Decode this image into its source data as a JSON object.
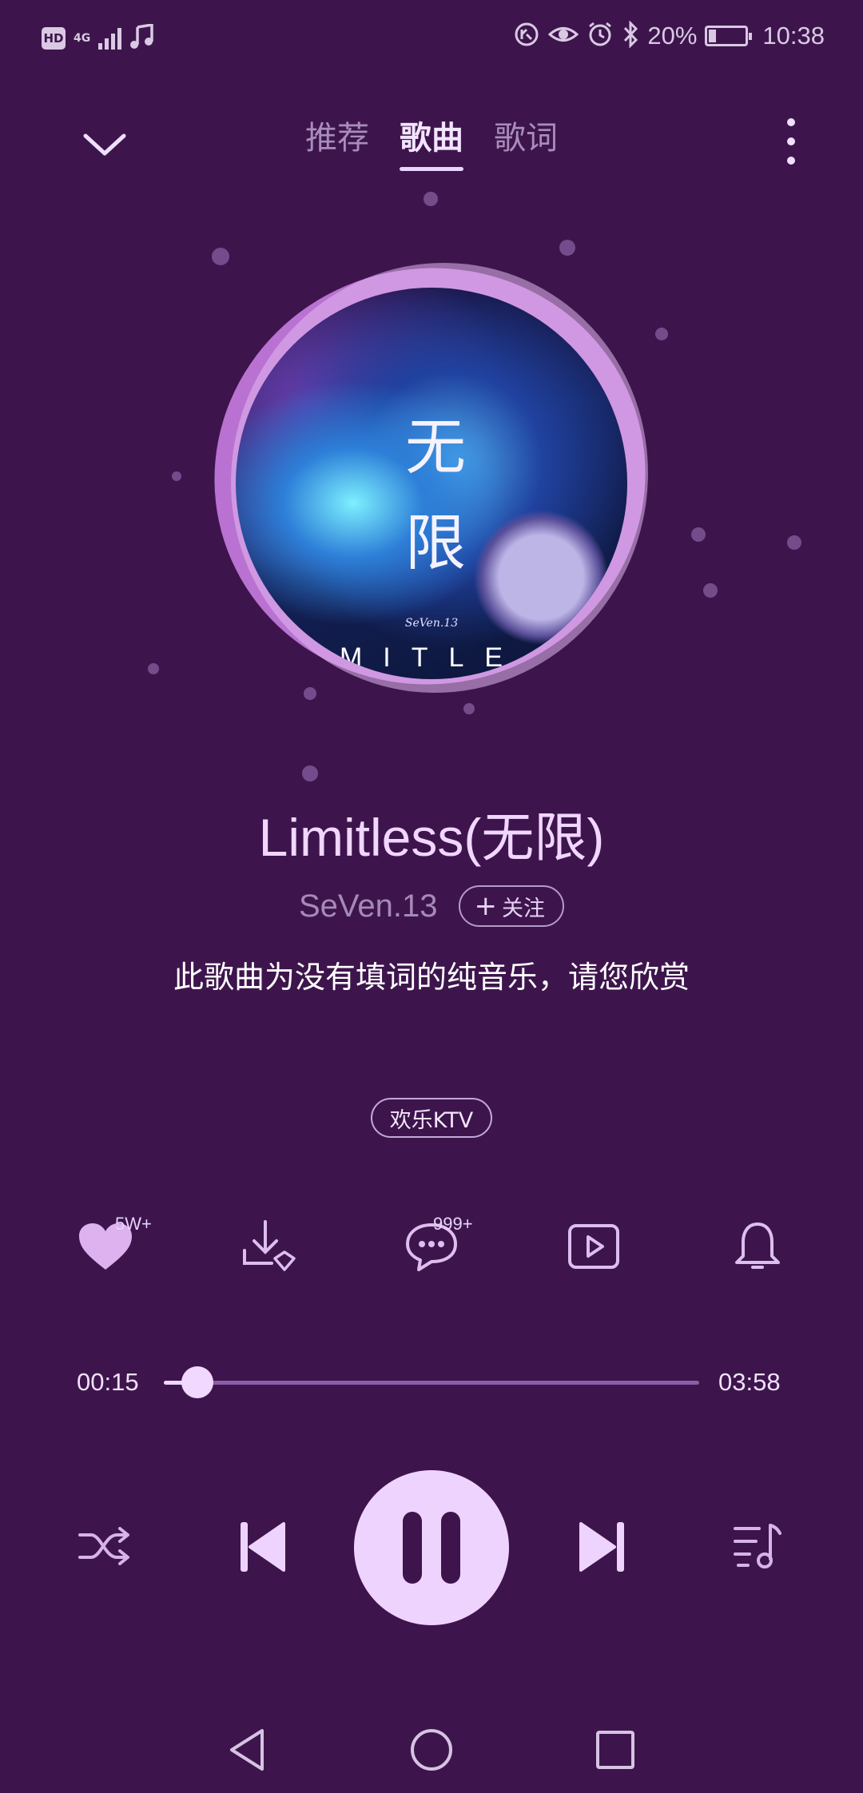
{
  "status_bar": {
    "hd_label": "HD",
    "network_label": "4G",
    "battery_percent": "20%",
    "time": "10:38",
    "battery_level": 0.2,
    "icons": [
      "music-note-icon",
      "data-saver-icon",
      "eye-comfort-icon",
      "alarm-icon",
      "bluetooth-icon",
      "battery-charging-icon"
    ]
  },
  "header": {
    "tabs": [
      {
        "label": "推荐",
        "active": false
      },
      {
        "label": "歌曲",
        "active": true
      },
      {
        "label": "歌词",
        "active": false
      }
    ],
    "collapse_icon": "chevron-down-icon",
    "more_icon": "more-vertical-icon"
  },
  "album_art": {
    "title_chars": [
      "无",
      "限"
    ],
    "artist_credit": "SeVen.13",
    "banner_text": "MITLE"
  },
  "song": {
    "title": "Limitless(无限)",
    "artist": "SeVen.13",
    "follow_label": "关注",
    "note": "此歌曲为没有填词的纯音乐，请您欣赏",
    "ktv_label": "欢乐KTV"
  },
  "actions": {
    "like_badge": "5W+",
    "comment_badge": "999+",
    "icons": [
      "heart-icon",
      "download-icon",
      "comment-icon",
      "video-icon",
      "bell-icon"
    ]
  },
  "progress": {
    "elapsed": "00:15",
    "total": "03:58",
    "fraction": 0.063
  },
  "controls": {
    "icons": [
      "shuffle-icon",
      "previous-icon",
      "pause-icon",
      "next-icon",
      "playlist-icon"
    ]
  },
  "nav_bar": {
    "icons": [
      "back-triangle-icon",
      "home-circle-icon",
      "recents-square-icon"
    ]
  },
  "colors": {
    "background": "#3d154c",
    "accent": "#efd3ff",
    "muted_text": "#a88dbb"
  }
}
